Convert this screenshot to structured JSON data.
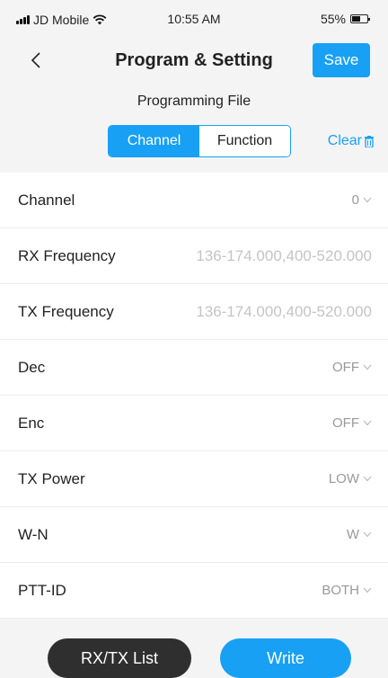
{
  "status_bar": {
    "carrier": "JD Mobile",
    "time": "10:55 AM",
    "battery_percent": "55%",
    "battery_level": 0.55,
    "icons": [
      "signal-icon",
      "wifi-icon",
      "battery-icon"
    ]
  },
  "header": {
    "back_icon": "chevron-left-icon",
    "title": "Program & Setting",
    "save_label": "Save"
  },
  "subtitle": "Programming File",
  "tabs": [
    {
      "label": "Channel",
      "active": true
    },
    {
      "label": "Function",
      "active": false
    }
  ],
  "clear": {
    "label": "Clear",
    "icon": "trash-icon"
  },
  "rows": [
    {
      "label": "Channel",
      "value": "0"
    },
    {
      "label": "RX Frequency",
      "placeholder": "136-174.000,400-520.000"
    },
    {
      "label": "TX Frequency",
      "placeholder": "136-174.000,400-520.000"
    },
    {
      "label": "Dec",
      "value": "OFF"
    },
    {
      "label": "Enc",
      "value": "OFF"
    },
    {
      "label": "TX Power",
      "value": "LOW"
    },
    {
      "label": "W-N",
      "value": "W"
    },
    {
      "label": "PTT-ID",
      "value": "BOTH"
    }
  ],
  "bottom": {
    "list_label": "RX/TX List",
    "write_label": "Write"
  },
  "colors": {
    "accent": "#18a0f5",
    "dark_button": "#2f2f2f",
    "placeholder": "#c4c4c4"
  }
}
